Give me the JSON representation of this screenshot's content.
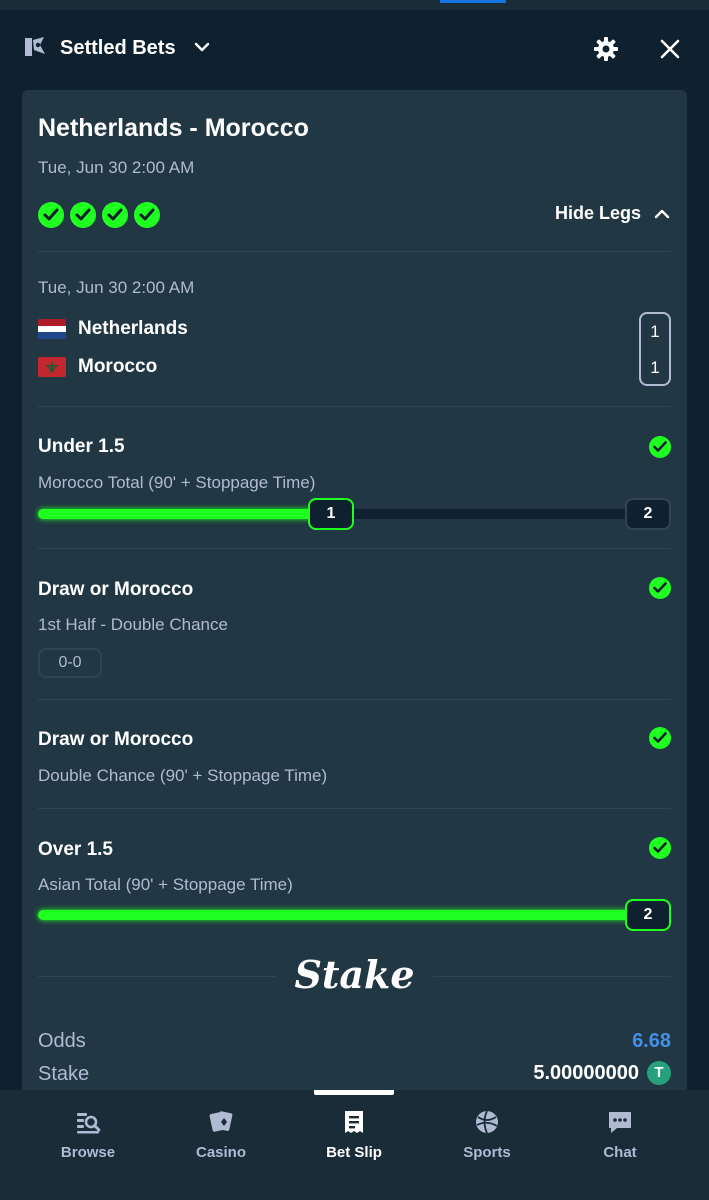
{
  "header": {
    "title": "Settled Bets",
    "icons": {
      "bet": "bet-slip-icon",
      "dropdown": "chevron-down-icon",
      "settings": "gear-icon",
      "close": "close-icon"
    }
  },
  "bet": {
    "match_title": "Netherlands - Morocco",
    "match_date": "Tue, Jun 30 2:00 AM",
    "legs_won": 4,
    "hide_legs_label": "Hide Legs",
    "event": {
      "date": "Tue, Jun 30  2:00 AM",
      "home_team": "Netherlands",
      "away_team": "Morocco",
      "home_score": "1",
      "away_score": "1"
    },
    "legs": [
      {
        "title": "Under 1.5",
        "subtitle": "Morocco Total (90' + Stoppage Time)",
        "progress_current": "1",
        "progress_target": "2",
        "progress_fraction": 0.5
      },
      {
        "title": "Draw or Morocco",
        "subtitle": "1st Half - Double Chance",
        "score_tag": "0-0"
      },
      {
        "title": "Draw or Morocco",
        "subtitle": "Double Chance (90' + Stoppage Time)"
      },
      {
        "title": "Over 1.5",
        "subtitle": "Asian Total (90' + Stoppage Time)",
        "progress_current": "2",
        "progress_fraction": 1.0
      }
    ],
    "brand": "Stake",
    "odds_label": "Odds",
    "odds_value": "6.68",
    "stake_label": "Stake",
    "stake_value": "5.00000000",
    "currency_symbol": "T"
  },
  "colors": {
    "win_green": "#1fff20",
    "odds_blue": "#4391e7",
    "bg": "#0f212e",
    "card": "#213743"
  },
  "bottom_nav": [
    {
      "label": "Browse",
      "icon": "browse-icon"
    },
    {
      "label": "Casino",
      "icon": "casino-icon"
    },
    {
      "label": "Bet Slip",
      "icon": "bet-slip-icon",
      "active": true
    },
    {
      "label": "Sports",
      "icon": "sports-icon"
    },
    {
      "label": "Chat",
      "icon": "chat-icon"
    }
  ]
}
